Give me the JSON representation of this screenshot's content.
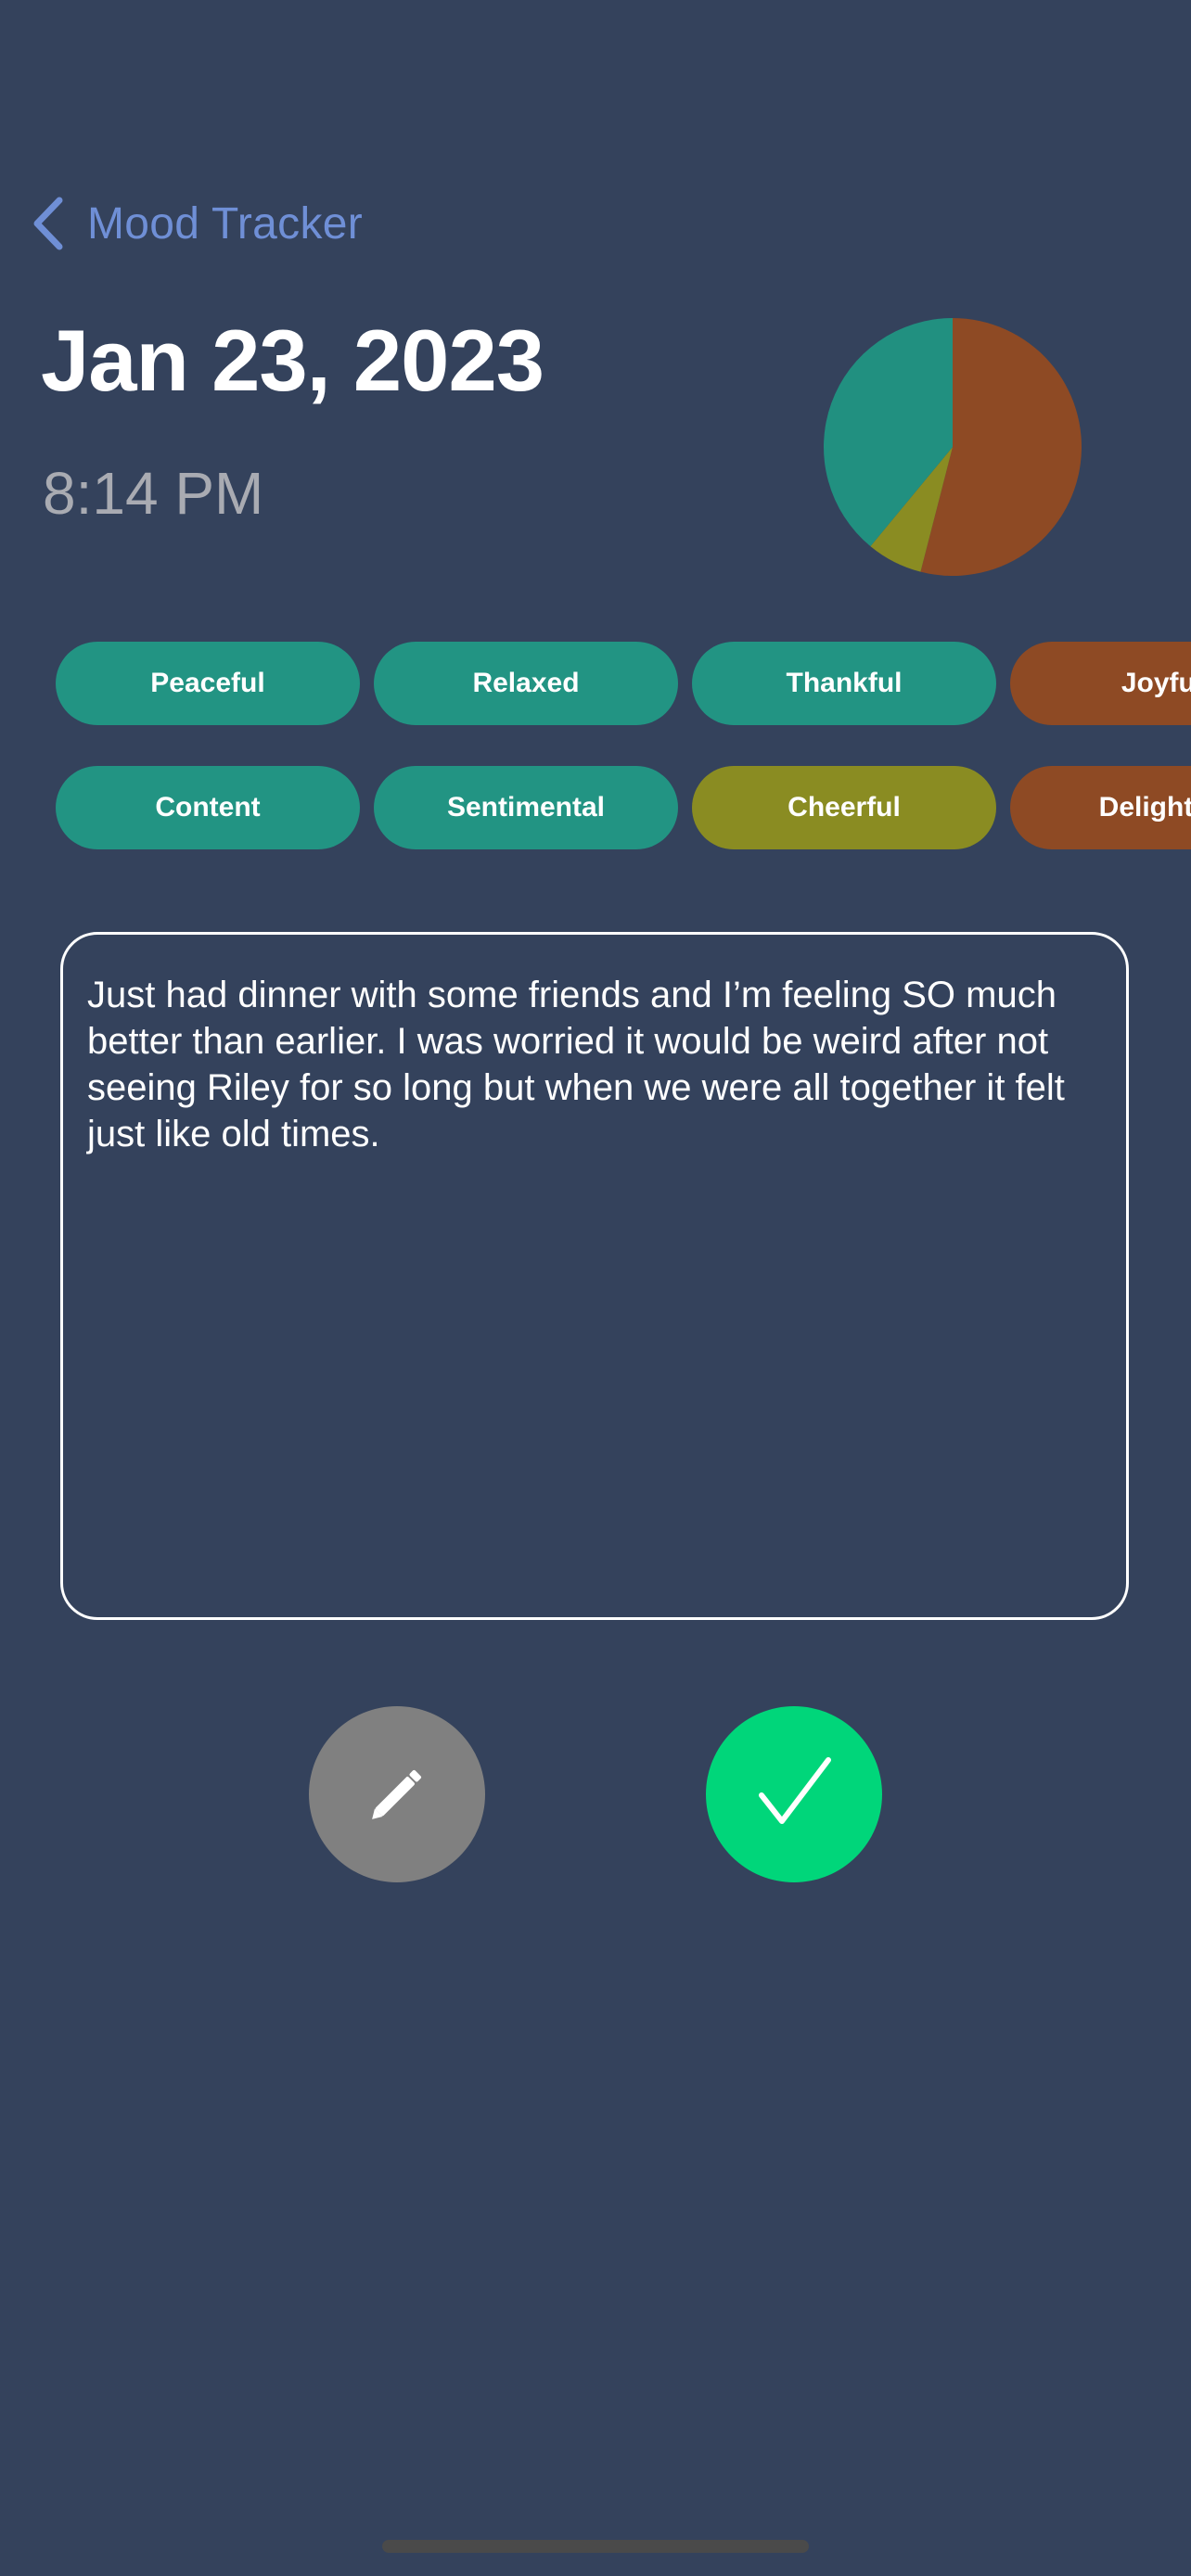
{
  "nav": {
    "back_label": "Mood Tracker"
  },
  "entry": {
    "date": "Jan 23, 2023",
    "time": "8:14 PM",
    "text": "Just had dinner with some friends and I’m feeling SO much better than earlier. I was worried it would be weird after not seeing Riley for so long but when we were all together it felt just like old times."
  },
  "chart_data": {
    "type": "pie",
    "slices": [
      {
        "color": "#8e4a24",
        "value": 0.54
      },
      {
        "color": "#8a8c22",
        "value": 0.07
      },
      {
        "color": "#219080",
        "value": 0.39
      }
    ]
  },
  "moods": {
    "row1": [
      {
        "label": "Peaceful",
        "color": "#229483"
      },
      {
        "label": "Relaxed",
        "color": "#229483"
      },
      {
        "label": "Thankful",
        "color": "#229483"
      },
      {
        "label": "Joyful",
        "color": "#8e4a24"
      }
    ],
    "row2": [
      {
        "label": "Content",
        "color": "#229483"
      },
      {
        "label": "Sentimental",
        "color": "#229483"
      },
      {
        "label": "Cheerful",
        "color": "#8a8c22"
      },
      {
        "label": "Delighted",
        "color": "#8e4a24"
      }
    ]
  },
  "actions": {
    "edit_icon": "pencil-icon",
    "save_icon": "checkmark-icon"
  },
  "colors": {
    "background": "#34425c",
    "accent": "#6f8fd6",
    "save": "#00d67a",
    "edit": "#808080"
  }
}
